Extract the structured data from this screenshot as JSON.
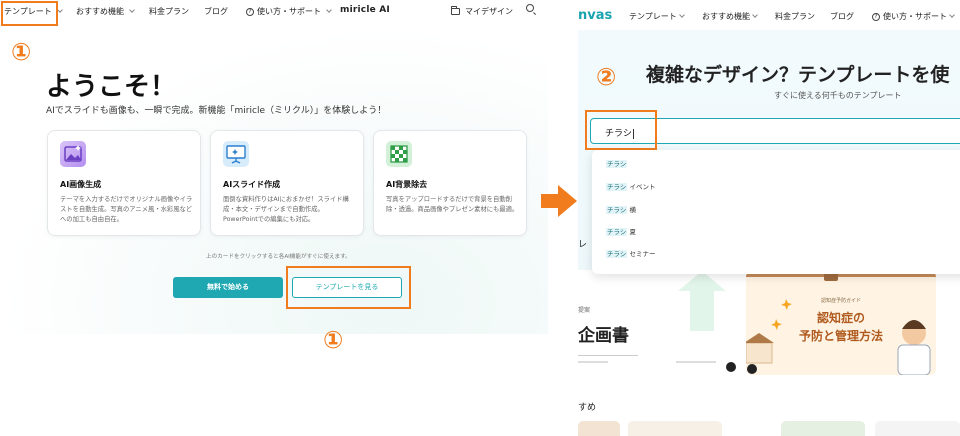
{
  "left": {
    "nav": {
      "templates": "テンプレート",
      "features": "おすすめ機能",
      "pricing": "料金プラン",
      "blog": "ブログ",
      "help": "使い方・サポート",
      "brand": "miricle AI",
      "my_design": "マイデザイン"
    },
    "step_marker": "①",
    "title": "ようこそ！",
    "subtitle": "AIでスライドも画像も、一瞬で完成。新機能「miricle（ミリクル）」を体験しよう！",
    "cards": [
      {
        "title": "AI画像生成",
        "desc": "テーマを入力するだけでオリジナル画像やイラストを自動生成。写真のアニメ風・水彩風などへの加工も自由自在。"
      },
      {
        "title": "AIスライド作成",
        "desc": "面倒な資料作りはAIにおまかせ！スライド構成・本文・デザインまで自動作成。PowerPointでの編集にも対応。"
      },
      {
        "title": "AI背景除去",
        "desc": "写真をアップロードするだけで背景を自動削除・透過。商品画像やプレゼン素材にも最適。"
      }
    ],
    "hint": "上のカードをクリックすると各AI機能がすぐに使えます。",
    "btn_free": "無料で始める",
    "btn_templates": "テンプレートを見る",
    "step_marker_bottom": "①"
  },
  "right": {
    "logo_partial": "nvas",
    "nav": {
      "templates": "テンプレート",
      "features": "おすすめ機能",
      "pricing": "料金プラン",
      "blog": "ブログ",
      "help": "使い方・サポート"
    },
    "step_marker": "②",
    "hero_title": "複雑なデザイン？テンプレートを使",
    "hero_sub": "すぐに使える何千ものテンプレート",
    "search_value": "チラシ",
    "suggestions": [
      {
        "match": "チラシ",
        "rest": ""
      },
      {
        "match": "チラシ",
        "rest": "イベント"
      },
      {
        "match": "チラシ",
        "rest": "横"
      },
      {
        "match": "チラシ",
        "rest": "夏"
      },
      {
        "match": "チラシ",
        "rest": "セミナー"
      }
    ],
    "section_label_partial": "レ",
    "thumb1_sub": "提案",
    "thumb1_title": "企画書",
    "thumb2_small": "認知症予防ガイド",
    "thumb2_title_line1": "認知症の",
    "thumb2_title_line2": "予防と管理方法",
    "recommend_partial": "すめ"
  },
  "colors": {
    "accent": "#f07c1e",
    "teal": "#1fa8b2"
  }
}
